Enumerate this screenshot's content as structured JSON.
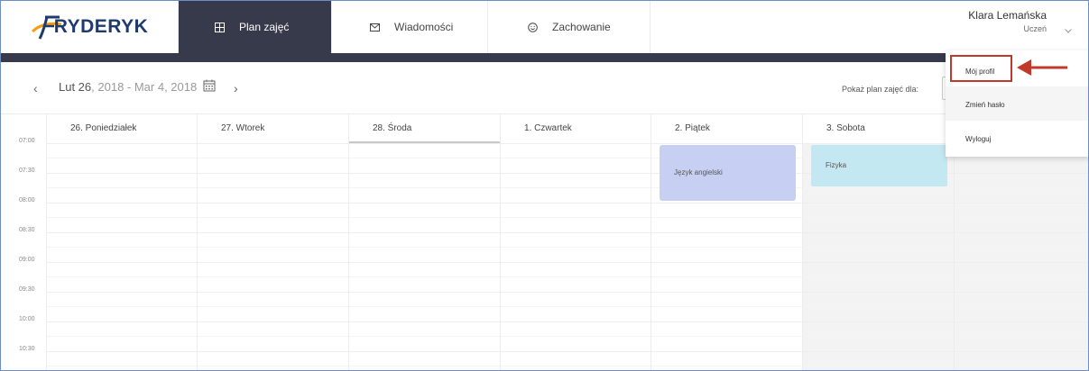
{
  "brand": {
    "name": "RYDERYK",
    "logo_icon": "f-swoosh-logo"
  },
  "nav": {
    "tabs": [
      {
        "label": "Plan zajęć",
        "icon": "grid-icon",
        "active": true
      },
      {
        "label": "Wiadomości",
        "icon": "envelope-icon",
        "active": false
      },
      {
        "label": "Zachowanie",
        "icon": "smiley-icon",
        "active": false
      }
    ]
  },
  "user": {
    "name": "Klara Lemańska",
    "role": "Uczeń"
  },
  "toolbar": {
    "prev": "‹",
    "next": "›",
    "date_start": "Lut 26",
    "date_rest": ", 2018 - Mar 4, 2018",
    "show_for_label": "Pokaż plan zajęć dla:"
  },
  "days": [
    {
      "label": "26. Poniedziałek"
    },
    {
      "label": "27. Wtorek"
    },
    {
      "label": "28. Środa",
      "active": true
    },
    {
      "label": "1. Czwartek"
    },
    {
      "label": "2. Piątek"
    },
    {
      "label": "3. Sobota"
    }
  ],
  "times": [
    "07:00",
    "07:30",
    "08:00",
    "08:30",
    "09:00",
    "09:30",
    "10:00",
    "10:30"
  ],
  "events": [
    {
      "title": "Język angielski",
      "day": "2. Piątek",
      "color": "#c7cff3"
    },
    {
      "title": "Fizyka",
      "day": "3. Sobota",
      "color": "#c4e8f1"
    }
  ],
  "dropdown": {
    "items": [
      {
        "label": "Mój profil"
      },
      {
        "label": "Zmień hasło"
      },
      {
        "label": "Wyloguj"
      }
    ]
  },
  "colors": {
    "nav_dark": "#363a4a",
    "highlight": "#c0392b",
    "brand_orange": "#f39c12",
    "brand_navy": "#1f3b6e"
  }
}
